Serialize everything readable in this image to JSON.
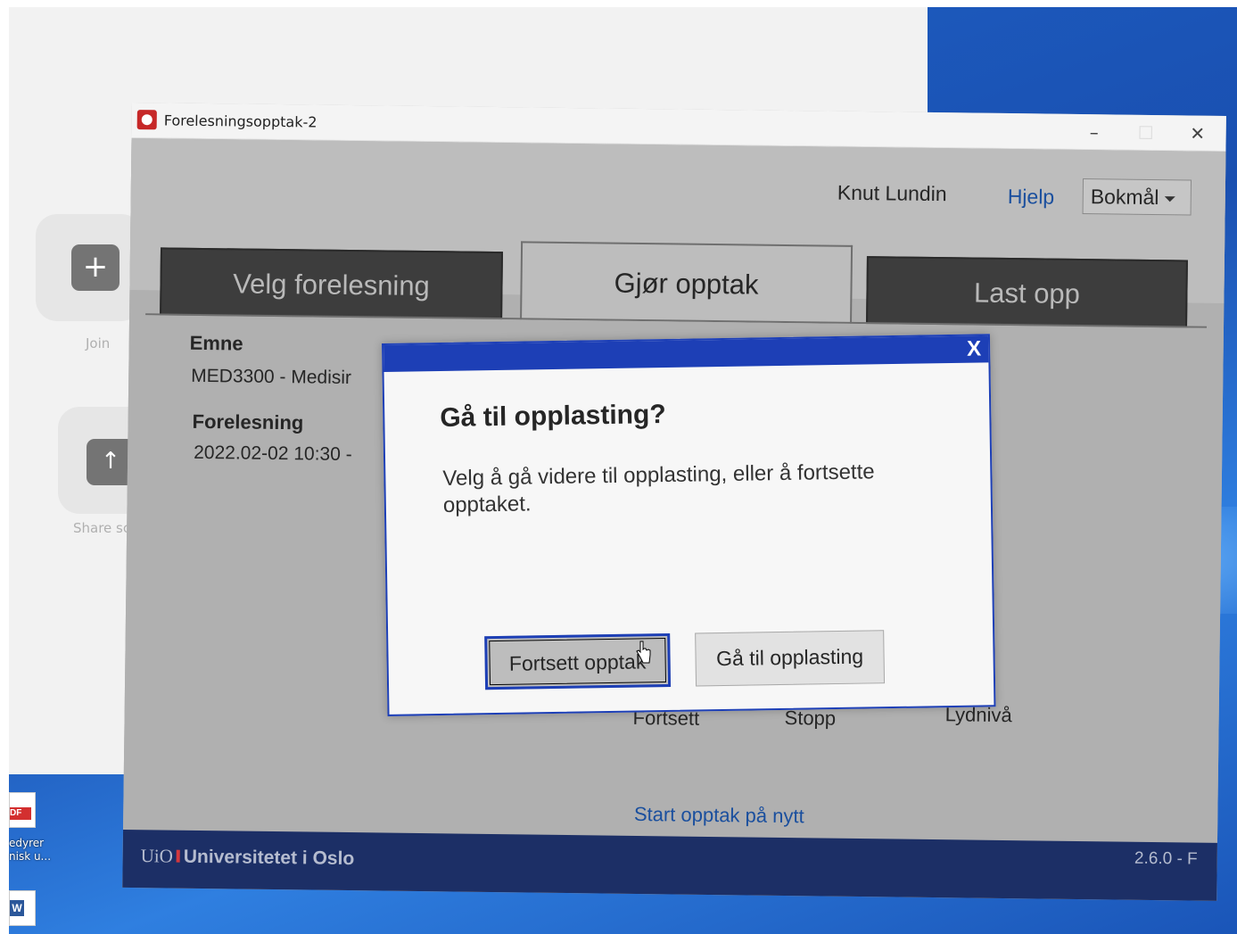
{
  "desktop": {
    "zoom_panel": {
      "join_label": "Join",
      "join_icon": "+",
      "share_label": "Share screen",
      "share_icon": "↑"
    },
    "icons": [
      {
        "type": "pdf",
        "label_line1": "edyrer",
        "label_line2": "nisk u..."
      },
      {
        "type": "word",
        "label_line1": "",
        "label_line2": ""
      }
    ]
  },
  "window": {
    "title": "Forelesningsopptak-2",
    "controls": {
      "minimize": "–",
      "maximize": "☐",
      "close": "✕"
    }
  },
  "header": {
    "user_name": "Knut Lundin",
    "help_label": "Hjelp",
    "language": "Bokmål"
  },
  "tabs": [
    {
      "label": "Velg forelesning",
      "active": false
    },
    {
      "label": "Gjør opptak",
      "active": true
    },
    {
      "label": "Last opp",
      "active": false
    }
  ],
  "main": {
    "course_label": "Emne",
    "course_value": "MED3300 - Medisir",
    "lecture_label": "Forelesning",
    "lecture_value": "2022.02-02 10:30 -",
    "controls": {
      "continue_label": "Fortsett",
      "stop_label": "Stopp",
      "level_label": "Lydnivå"
    },
    "restart_label": "Start opptak på nytt"
  },
  "footer": {
    "logo_text": "UiO",
    "institution": "Universitetet i Oslo",
    "version": "2.6.0 - F"
  },
  "dialog": {
    "close_label": "X",
    "title": "Gå til opplasting?",
    "message": "Velg å gå videre til opplasting, eller å fortsette opptaket.",
    "continue_button": "Fortsett opptak",
    "upload_button": "Gå til opplasting"
  },
  "colors": {
    "dialog_accent": "#1d3fb6",
    "link": "#1a4f9e",
    "footer": "#1c2f66",
    "inactive_tab": "#3d3d3d"
  }
}
